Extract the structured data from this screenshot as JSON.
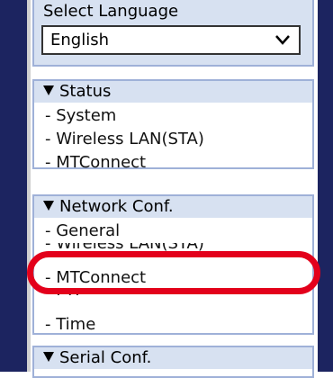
{
  "language_panel": {
    "title": "Select Language",
    "selected": "English"
  },
  "status_panel": {
    "title": "Status",
    "items": [
      {
        "label": "- System"
      },
      {
        "label": "- Wireless LAN(STA)"
      },
      {
        "label": "- MTConnect"
      }
    ]
  },
  "network_panel": {
    "title": "Network Conf.",
    "items": [
      {
        "label": "- General"
      },
      {
        "label": "- Wireless LAN(STA)"
      },
      {
        "label": "- MTConnect"
      },
      {
        "label": "- FTP"
      },
      {
        "label": "- Time"
      }
    ]
  },
  "serial_panel": {
    "title": "Serial Conf."
  },
  "colors": {
    "frame": "#1c2460",
    "panel_header": "#d7e1f1",
    "highlight": "#e3001b"
  }
}
